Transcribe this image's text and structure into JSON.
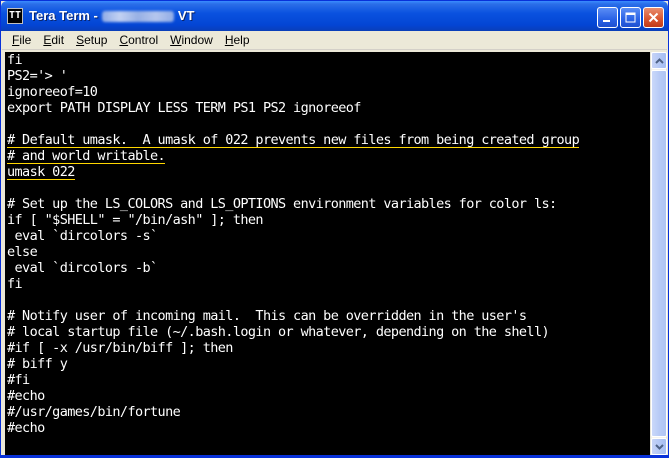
{
  "window": {
    "app_name": "Tera Term -",
    "title_suffix": "VT",
    "icon_glyph": "TT"
  },
  "menu": {
    "items": [
      {
        "underline": "F",
        "rest": "ile"
      },
      {
        "underline": "E",
        "rest": "dit"
      },
      {
        "underline": "S",
        "rest": "etup"
      },
      {
        "underline": "C",
        "rest": "ontrol"
      },
      {
        "underline": "W",
        "rest": "indow"
      },
      {
        "underline": "H",
        "rest": "elp"
      }
    ]
  },
  "terminal": {
    "lines": [
      "fi",
      "PS2='> '",
      "ignoreeof=10",
      "export PATH DISPLAY LESS TERM PS1 PS2 ignoreeof",
      "",
      "# Default umask.  A umask of 022 prevents new files from being created group",
      "# and world writable.",
      "umask 022",
      "",
      "# Set up the LS_COLORS and LS_OPTIONS environment variables for color ls:",
      "if [ \"$SHELL\" = \"/bin/ash\" ]; then",
      " eval `dircolors -s`",
      "else",
      " eval `dircolors -b`",
      "fi",
      "",
      "# Notify user of incoming mail.  This can be overridden in the user's",
      "# local startup file (~/.bash.login or whatever, depending on the shell)",
      "#if [ -x /usr/bin/biff ]; then",
      "# biff y",
      "#fi",
      "#echo",
      "#/usr/games/bin/fortune",
      "#echo"
    ]
  },
  "colors": {
    "terminal_bg": "#000000",
    "terminal_fg": "#FFFFFF",
    "highlight_underline": "#FFD700",
    "titlebar_blue": "#0A52E0"
  }
}
